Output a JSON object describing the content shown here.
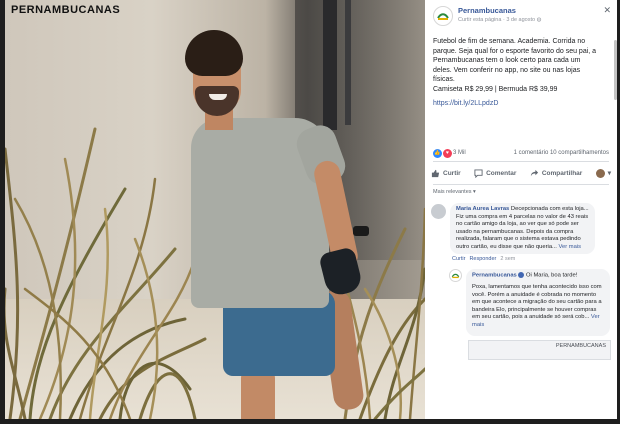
{
  "photo": {
    "brand_watermark": "PERNAMBUCANAS"
  },
  "post": {
    "page_name": "Pernambucanas",
    "action": "Curtir esta página",
    "date": "3 de agosto",
    "close_icon": "close-icon",
    "body_lines": [
      "Futebol de fim de semana. Academia. Corrida no",
      "parque. Seja qual for o esporte favorito do seu pai, a",
      "Pernambucanas tem o look certo para cada um",
      "deles. Vem conferir no app, no site ou nas lojas",
      "físicas.",
      "Camiseta R$ 29,99 | Bermuda R$ 39,99"
    ],
    "link": "https://bit.ly/2LLpdzD",
    "reaction_count": "3 Mil",
    "comment_count": "1 comentário",
    "share_count": "10 compartilhamentos",
    "like_label": "Curtir",
    "comment_label": "Comentar",
    "share_label": "Compartilhar",
    "sort_label": "Mais relevantes ▾"
  },
  "comment": {
    "author": "Maria Aurea Lavras",
    "text": "Decepcionada com esta loja... Fiz uma compra em 4 parcelas no valor de 43 reais no cartão amigo da loja, ao ver que só pode ser usado na pernambucanas. Depois da compra realizada, falaram que o sistema estava pedindo outro cartão, eu disse que não queria...",
    "more": "Ver mais",
    "like": "Curtir",
    "reply": "Responder",
    "time": "2 sem"
  },
  "reply": {
    "author": "Pernambucanas",
    "greeting": "Oi Maria, boa tarde!",
    "text": "Poxa, lamentamos que tenha acontecido isso com você. Porém a anuidade é cobrada no momento em que acontece a migração do seu cartão para a bandeira Elo, principalmente se houver compras em seu cartão, pois a anuidade só será cob...",
    "more": "Ver mais",
    "preview_label": "PERNAMBUCANAS"
  }
}
